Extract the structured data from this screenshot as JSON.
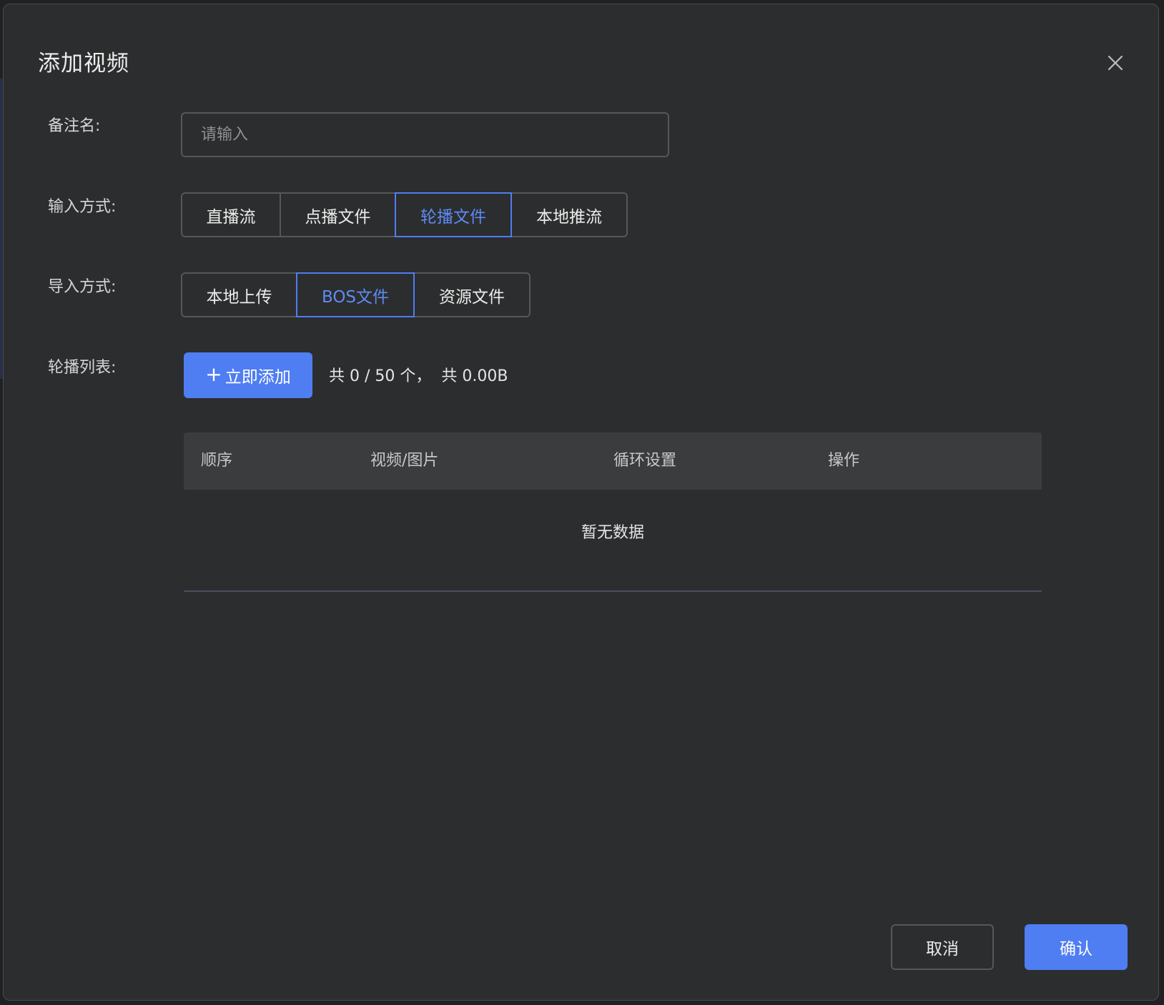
{
  "dialog": {
    "title": "添加视频",
    "close_icon": "close-icon"
  },
  "form": {
    "remark": {
      "label": "备注名:",
      "placeholder": "请输入",
      "value": ""
    },
    "input_mode": {
      "label": "输入方式:",
      "options": [
        "直播流",
        "点播文件",
        "轮播文件",
        "本地推流"
      ],
      "selected": "轮播文件"
    },
    "import_mode": {
      "label": "导入方式:",
      "options": [
        "本地上传",
        "BOS文件",
        "资源文件"
      ],
      "selected": "BOS文件"
    },
    "carousel_list": {
      "label": "轮播列表:",
      "add_button": "立即添加",
      "add_icon": "plus-icon",
      "count_text": "共 0 / 50 个，  共 0.00B"
    }
  },
  "table": {
    "columns": [
      "顺序",
      "视频/图片",
      "循环设置",
      "操作"
    ],
    "rows": [],
    "empty_text": "暂无数据"
  },
  "footer": {
    "cancel_label": "取消",
    "confirm_label": "确认"
  },
  "colors": {
    "accent": "#4f7df2",
    "dialog_bg": "#2c2d2e",
    "border": "#555759"
  }
}
